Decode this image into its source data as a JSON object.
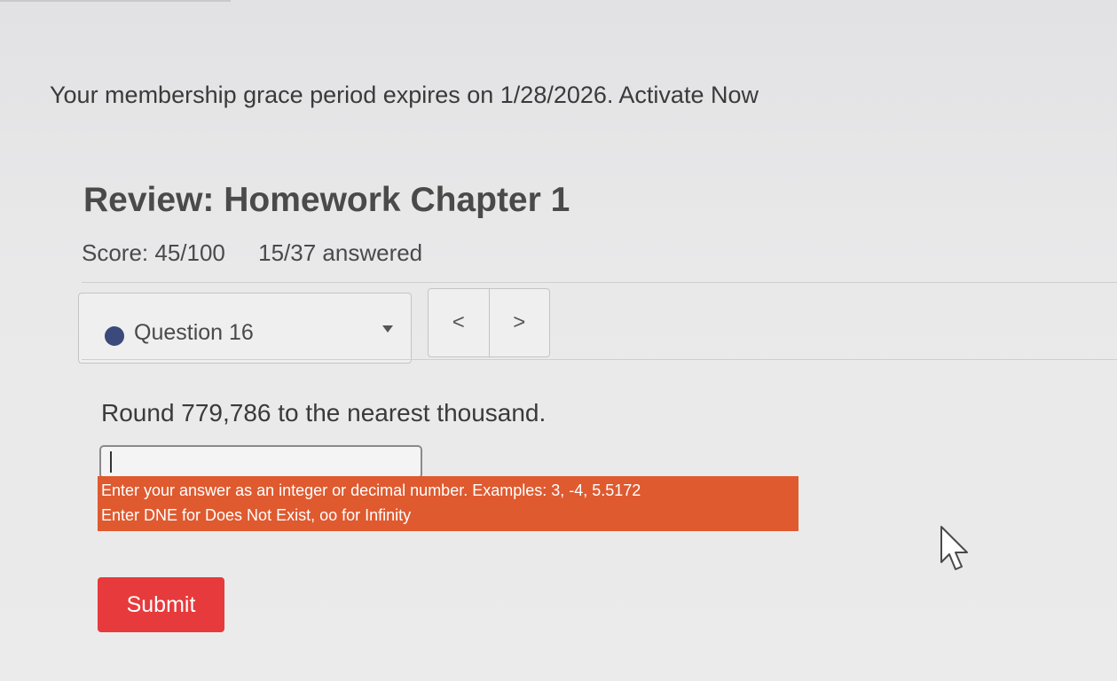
{
  "banner": {
    "text": "Your membership grace period expires on 1/28/2026.",
    "link": "Activate Now"
  },
  "assignment": {
    "title": "Review: Homework Chapter 1",
    "score": "Score: 45/100",
    "answered": "15/37 answered"
  },
  "question_nav": {
    "selected": "Question 16",
    "prev_icon": "chevron-left",
    "prev_label": "<",
    "next_icon": "chevron-right",
    "next_label": ">"
  },
  "question": {
    "prompt": "Round 779,786 to the nearest thousand.",
    "answer_value": ""
  },
  "hint": {
    "line1": "Enter your answer as an integer or decimal number. Examples: 3, -4, 5.5172",
    "line2": "Enter DNE for Does Not Exist, oo for Infinity"
  },
  "actions": {
    "submit_label": "Submit"
  },
  "colors": {
    "hint_background": "#df5a2f",
    "submit_background": "#e63a3c",
    "status_dot": "#3b4a7a"
  }
}
